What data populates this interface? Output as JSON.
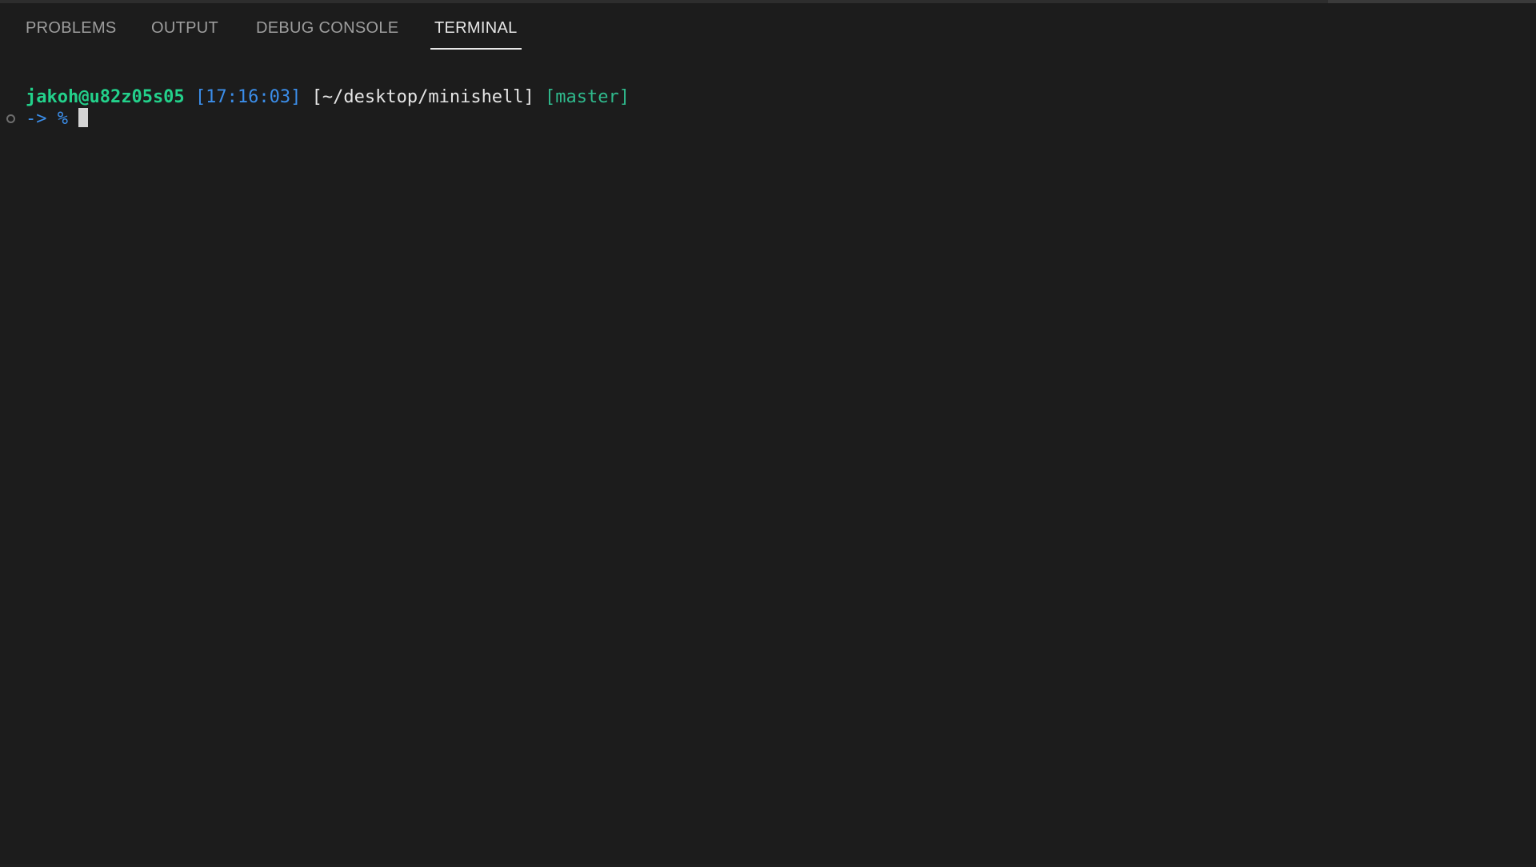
{
  "tabs": [
    {
      "label": "PROBLEMS",
      "active": false
    },
    {
      "label": "OUTPUT",
      "active": false
    },
    {
      "label": "DEBUG CONSOLE",
      "active": false
    },
    {
      "label": "TERMINAL",
      "active": true
    }
  ],
  "terminal": {
    "prompt_line": {
      "user": "jakoh@u82z05s05",
      "time": "[17:16:03]",
      "path": "[~/desktop/minishell]",
      "branch": "[master]"
    },
    "input_line": {
      "arrow": "->",
      "symbol": "%",
      "value": ""
    }
  },
  "colors": {
    "background": "#1c1c1c",
    "user": "#23d18b",
    "time": "#3b8eea",
    "path": "#e5e5e5",
    "branch": "#2fb98c",
    "tab_inactive": "#9d9d9d",
    "tab_active": "#e7e7e7"
  }
}
